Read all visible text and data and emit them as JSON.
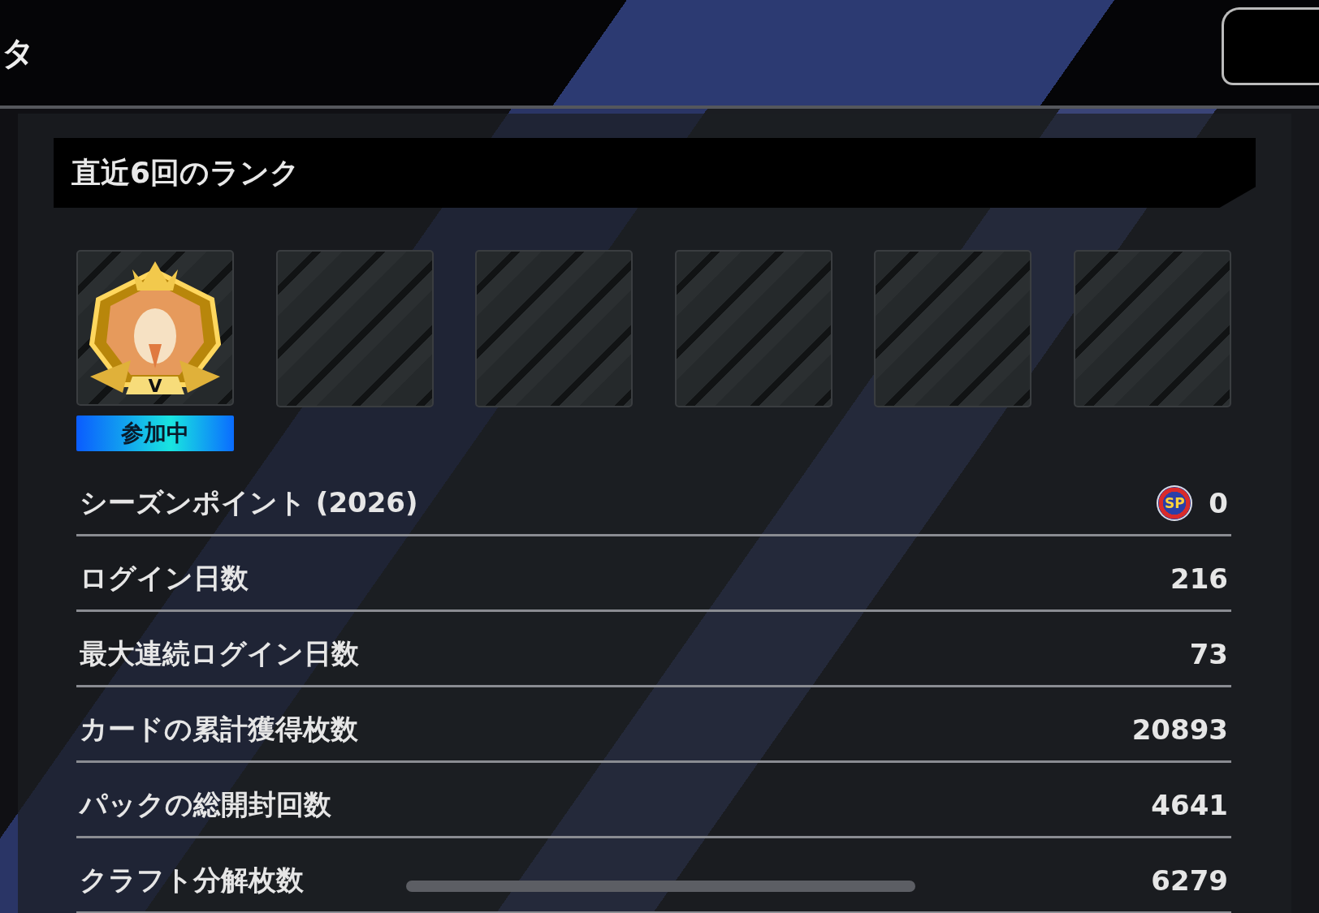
{
  "header": {
    "title": "タ"
  },
  "rank_section": {
    "title": "直近6回のランク",
    "slots": [
      {
        "kind": "emblem",
        "tier": "V",
        "status": "参加中"
      },
      {
        "kind": "empty"
      },
      {
        "kind": "empty"
      },
      {
        "kind": "empty"
      },
      {
        "kind": "empty"
      },
      {
        "kind": "empty"
      }
    ]
  },
  "stats": [
    {
      "label": "シーズンポイント (2026)",
      "value": "0",
      "icon_text": "SP"
    },
    {
      "label": "ログイン日数",
      "value": "216"
    },
    {
      "label": "最大連続ログイン日数",
      "value": "73"
    },
    {
      "label": "カードの累計獲得枚数",
      "value": "20893"
    },
    {
      "label": "パックの総開封回数",
      "value": "4641"
    },
    {
      "label": "クラフト分解枚数",
      "value": "6279"
    }
  ]
}
